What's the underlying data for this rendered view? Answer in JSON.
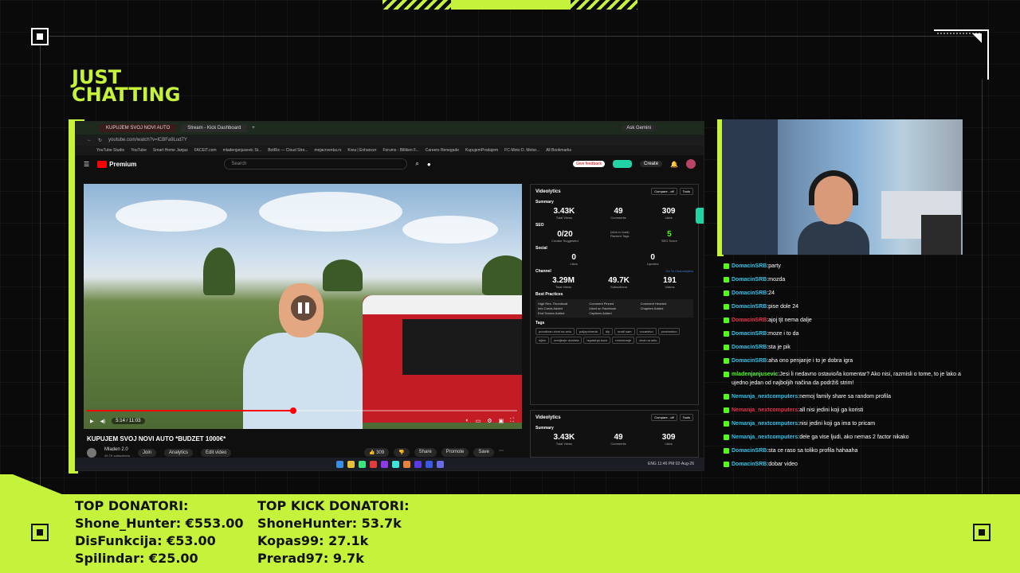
{
  "category": {
    "line1": "JUST",
    "line2": "CHATTING"
  },
  "browser": {
    "tabs": [
      "KUPUJEM SVOJ NOVI AUTO",
      "Stream - Kick Dashboard"
    ],
    "ask_gemini": "Ask Gemini",
    "url": "youtube.com/watch?v=lCBFa9Lud7Y",
    "bookmarks": [
      "YouTube Studio",
      "YouTube",
      "Smart Home Janjus",
      "FACEIT.com",
      "mladenjanjusevic St...",
      "BotRix — Cloud Stre...",
      "mojacrvenka.rs",
      "Krea | Enhancer",
      "Forums - Billiken F...",
      "Careers Renegade",
      "KupujemProdajem",
      "FC-Moto D. Motor...",
      "All Bookmarks"
    ]
  },
  "youtube": {
    "logo": "Premium",
    "search_placeholder": "Search",
    "give_feedback": "Give feedback",
    "create": "Create",
    "video_time": "5:14 / 11:03",
    "progress": 0.48,
    "title": "KUPUJEM SVOJ NOVI AUTO *BUDZET 1000€*",
    "channel": "Mladen 2.0",
    "subscribers": "49.7K subscribers",
    "join": "Join",
    "analytics": "Analytics",
    "edit_video": "Edit video",
    "likes": "309",
    "share": "Share",
    "promote": "Promote",
    "save": "Save"
  },
  "vidiq": {
    "title": "Videolytics",
    "compare": "Compare - off",
    "tools": "Tools",
    "summary_label": "Summary",
    "summary": [
      {
        "value": "3.43K",
        "label": "Total Views"
      },
      {
        "value": "49",
        "label": "Comments"
      },
      {
        "value": "309",
        "label": "Likes"
      }
    ],
    "seo_label": "SEO",
    "seo": [
      {
        "value": "0/20",
        "label": "Creator Suggested"
      },
      {
        "value": "(click to load)",
        "label": "Ranked Tags"
      },
      {
        "value": "5",
        "label": "SEO Score"
      }
    ],
    "social_label": "Social",
    "social": [
      {
        "value": "0",
        "label": "Likes"
      },
      {
        "value": "0",
        "label": "Upvotes"
      }
    ],
    "channel_label": "Channel",
    "go_to_channel": "Go To Channelytics",
    "channel": [
      {
        "value": "3.29M",
        "label": "Total Views"
      },
      {
        "value": "49.7K",
        "label": "Subscribers"
      },
      {
        "value": "191",
        "label": "Videos"
      }
    ],
    "best_practices_label": "Best Practices",
    "best_practices": [
      "High Res. Thumbnail",
      "Comment Pinned",
      "Comment Hearted",
      "Info Cards Added",
      "Liked on Facebook",
      "Chapters Added",
      "End Screen Added",
      "Captions Added"
    ],
    "tags_label": "Tags",
    "tags": [
      "porodican zivot na selu",
      "poljoprivreda",
      "diy",
      "uradi sam",
      "vocarstvo",
      "povrtarstvo",
      "sljive",
      "uredjenje dvorista",
      "izgradnja kuce",
      "renoviranje",
      "zivot na selu"
    ]
  },
  "taskbar": {
    "time": "11:46 PM",
    "date": "02-Aug-26",
    "lang": "ENG"
  },
  "chat": [
    {
      "user": "DomacinSRB",
      "color": "#33c1e8",
      "msg": ":party"
    },
    {
      "user": "DomacinSRB",
      "color": "#33c1e8",
      "msg": ":mozda"
    },
    {
      "user": "DomacinSRB",
      "color": "#33c1e8",
      "msg": ":24"
    },
    {
      "user": "DomacinSRB",
      "color": "#33c1e8",
      "msg": ":pise dole 24"
    },
    {
      "user": "DomacinSRB",
      "color": "#e8334a",
      "msg": ":ajoj tjt nema dalje"
    },
    {
      "user": "DomacinSRB",
      "color": "#33c1e8",
      "msg": ":moze i to da"
    },
    {
      "user": "DomacinSRB",
      "color": "#33c1e8",
      "msg": ":sta je pik"
    },
    {
      "user": "DomacinSRB",
      "color": "#33c1e8",
      "msg": ":aha ono penjanje i to je dobra igra"
    },
    {
      "user": "mladenjanjusevic",
      "color": "#53fc18",
      "msg": ":Jesi li nedavno ostavio/la komentar? Ako nisi, razmisli o tome, to je lako a ujedno jedan od najboljih načina da podržiš strim!"
    },
    {
      "user": "Nemanja_nextcomputers",
      "color": "#33c1e8",
      "msg": ":nemoj family share sa random profila"
    },
    {
      "user": "Nemanja_nextcomputers",
      "color": "#e8334a",
      "msg": ":all nisi jedini koji ga koristi"
    },
    {
      "user": "Nemanja_nextcomputers",
      "color": "#33c1e8",
      "msg": ":nisi jedini koji ga ima to pricam"
    },
    {
      "user": "Nemanja_nextcomputers",
      "color": "#33c1e8",
      "msg": ":dele ga vise ljudi, ako nemas 2 factor nikako"
    },
    {
      "user": "DomacinSRB",
      "color": "#33c1e8",
      "msg": ":sta ce raso sa toliko profila hahaaha"
    },
    {
      "user": "DomacinSRB",
      "color": "#33c1e8",
      "msg": ":dobar video"
    }
  ],
  "donors": {
    "title": "TOP DONATORI:",
    "list": [
      "Shone_Hunter: €553.00",
      "DisFunkcija: €53.00",
      "Spilindar: €25.00"
    ]
  },
  "kick_donors": {
    "title": "TOP KICK DONATORI:",
    "list": [
      "ShoneHunter: 53.7k",
      "Kopas99: 27.1k",
      "Prerad97: 9.7k"
    ]
  },
  "colors": {
    "accent": "#c5f23a",
    "kick_green": "#53fc18"
  }
}
